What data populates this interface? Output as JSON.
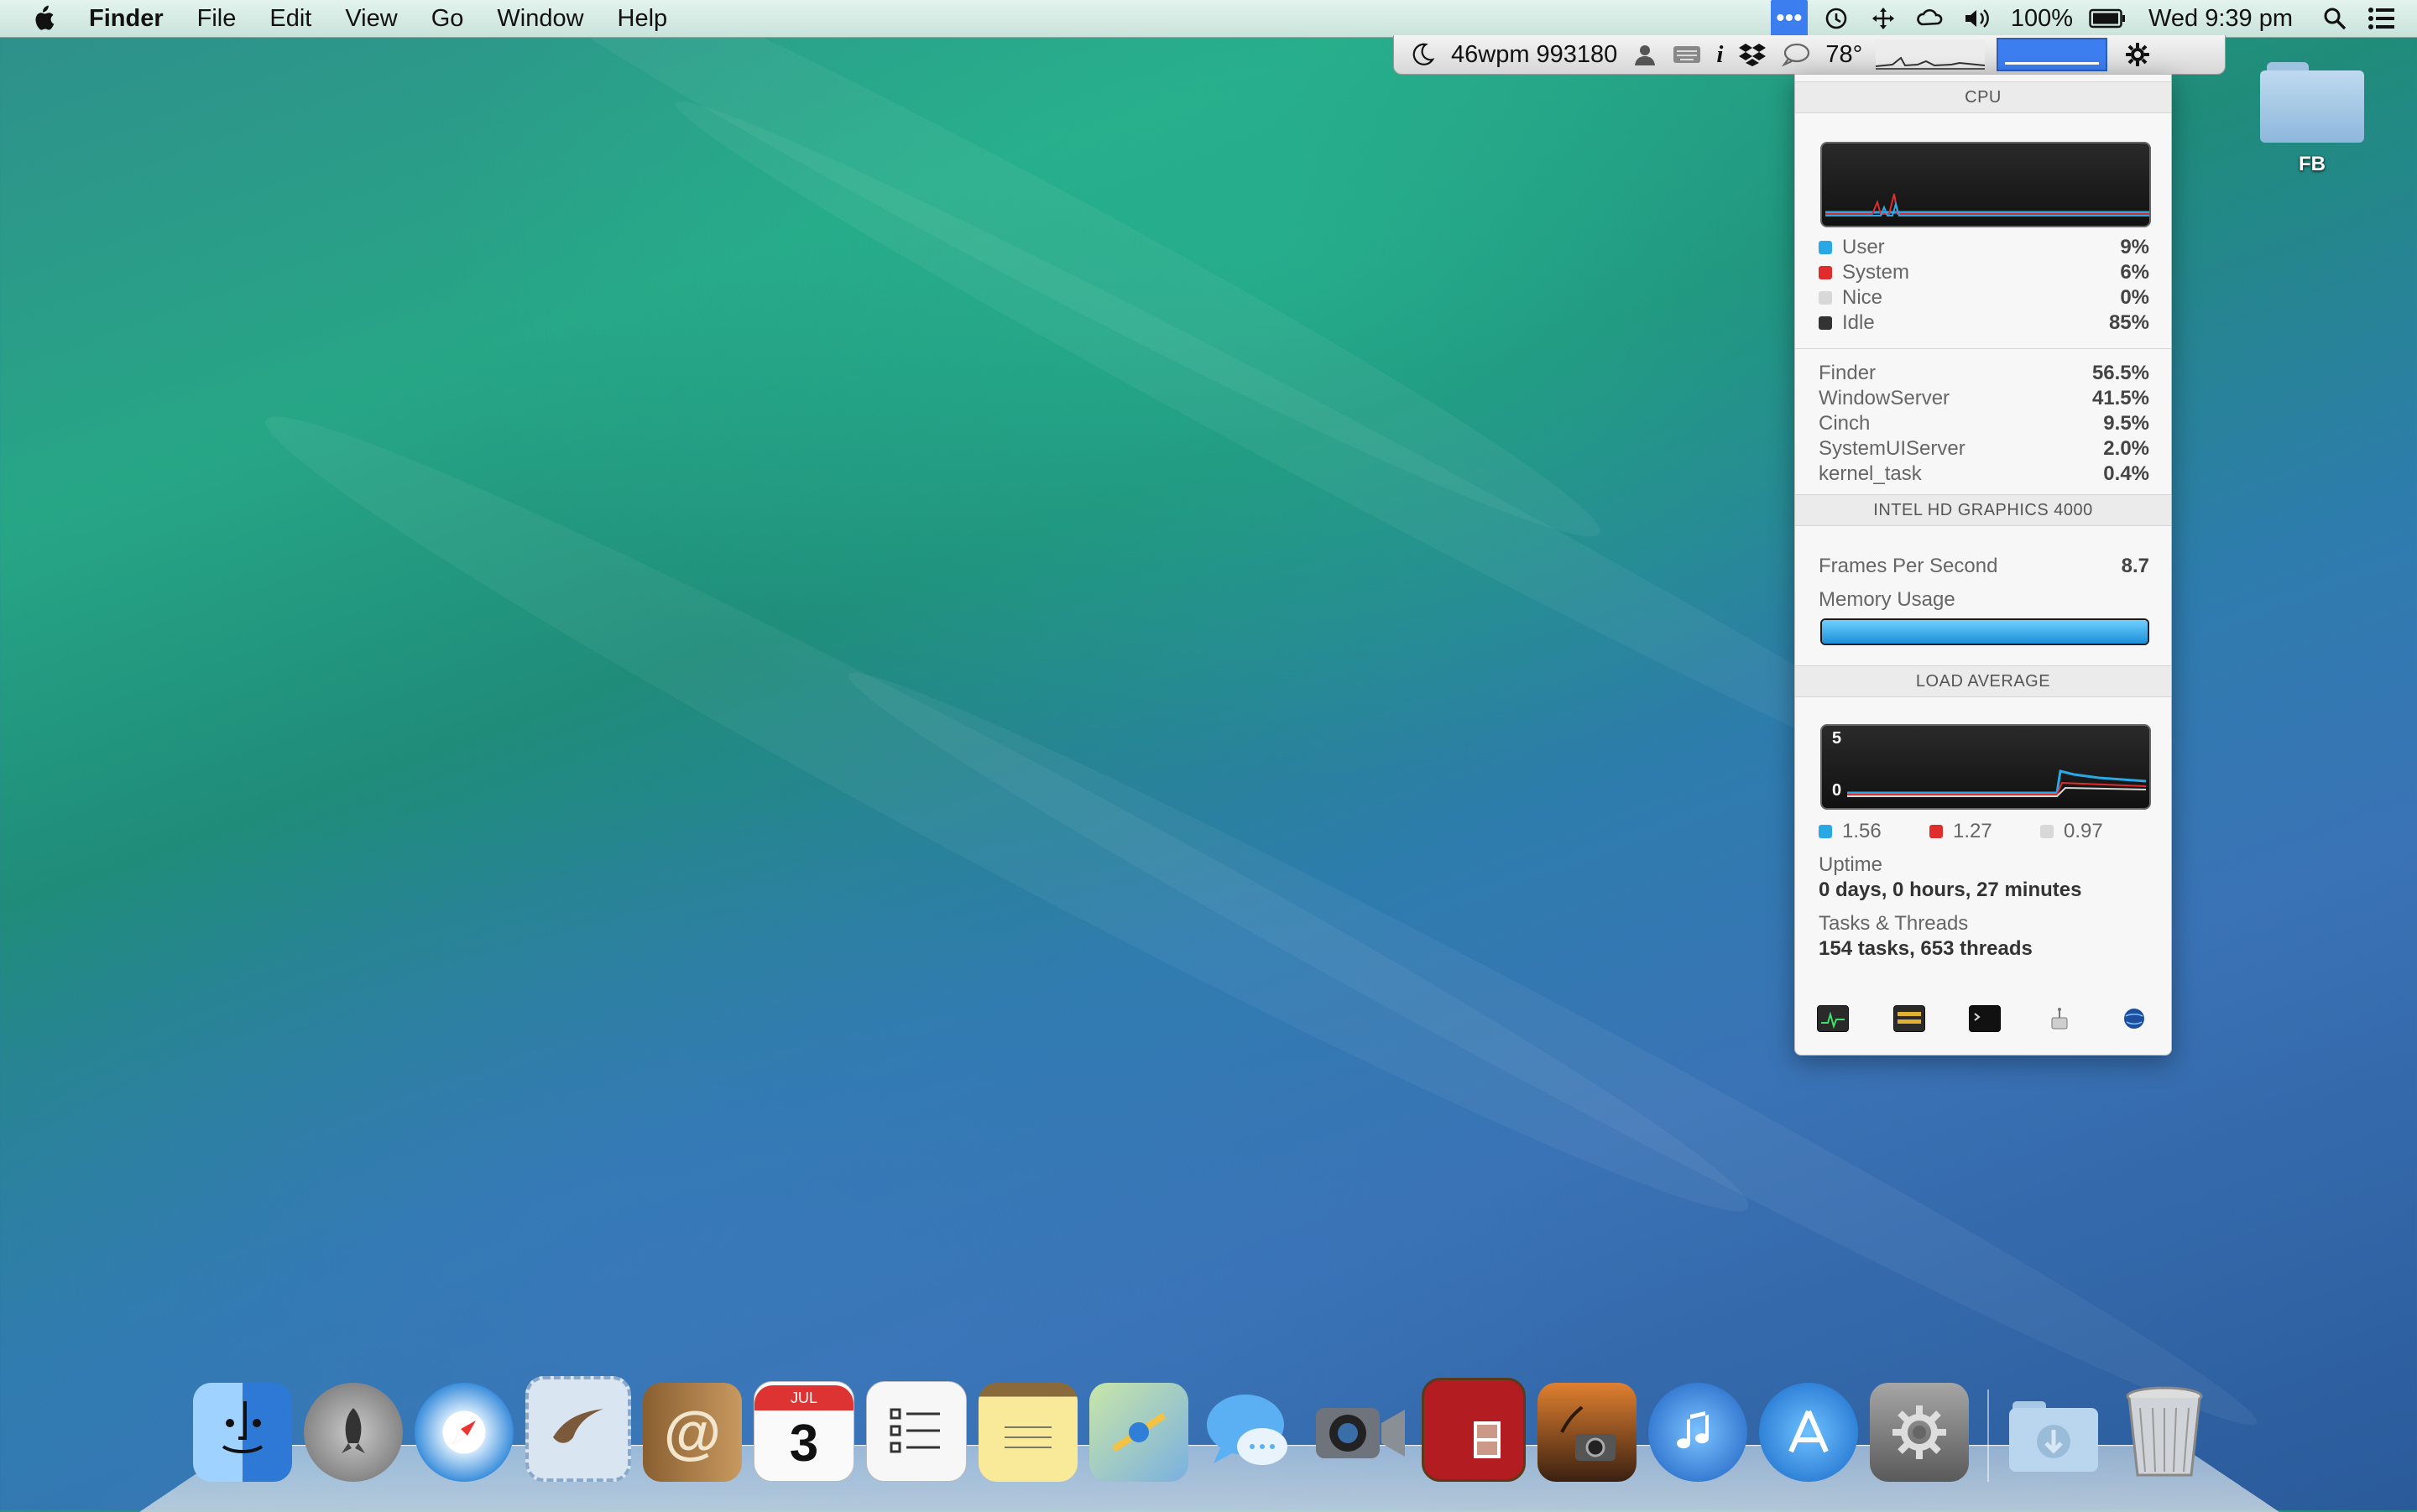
{
  "menubar": {
    "app_name": "Finder",
    "menus": [
      "File",
      "Edit",
      "View",
      "Go",
      "Window",
      "Help"
    ],
    "battery": "100%",
    "clock": "Wed 9:39 pm"
  },
  "statusbar": {
    "typing_stats": "46wpm 993180",
    "temperature": "78°"
  },
  "panel": {
    "cpu_header": "CPU",
    "cpu_legend": [
      {
        "label": "User",
        "value": "9%",
        "color": "#2aa8e6"
      },
      {
        "label": "System",
        "value": "6%",
        "color": "#e02c2c"
      },
      {
        "label": "Nice",
        "value": "0%",
        "color": "#d8d8d8"
      },
      {
        "label": "Idle",
        "value": "85%",
        "color": "#333333"
      }
    ],
    "processes": [
      {
        "name": "Finder",
        "value": "56.5%"
      },
      {
        "name": "WindowServer",
        "value": "41.5%"
      },
      {
        "name": "Cinch",
        "value": "9.5%"
      },
      {
        "name": "SystemUIServer",
        "value": "2.0%"
      },
      {
        "name": "kernel_task",
        "value": "0.4%"
      }
    ],
    "gpu_header": "INTEL HD GRAPHICS 4000",
    "fps_label": "Frames Per Second",
    "fps_value": "8.7",
    "memory_label": "Memory Usage",
    "memory_fraction": 1.0,
    "load_header": "LOAD AVERAGE",
    "load_scale_max": "5",
    "load_scale_min": "0",
    "load_values": [
      {
        "value": "1.56",
        "color": "#2aa8e6"
      },
      {
        "value": "1.27",
        "color": "#e02c2c"
      },
      {
        "value": "0.97",
        "color": "#d8d8d8"
      }
    ],
    "uptime_label": "Uptime",
    "uptime_value": "0 days, 0 hours, 27 minutes",
    "tasks_label": "Tasks & Threads",
    "tasks_value": "154 tasks, 653 threads"
  },
  "desktop": {
    "folder_name": "FB"
  },
  "dock": {
    "items": [
      {
        "name": "finder",
        "color": "#4c9be8"
      },
      {
        "name": "launchpad",
        "color": "#8e8e8e"
      },
      {
        "name": "safari",
        "color": "#3b8fd6"
      },
      {
        "name": "mail",
        "color": "#8fb3d8"
      },
      {
        "name": "contacts",
        "color": "#b68a4c"
      },
      {
        "name": "calendar",
        "color": "#f2f2f2"
      },
      {
        "name": "reminders",
        "color": "#f4f4f4"
      },
      {
        "name": "notes",
        "color": "#f4e38a"
      },
      {
        "name": "maps",
        "color": "#9dc97a"
      },
      {
        "name": "messages",
        "color": "#5aaef0"
      },
      {
        "name": "facetime",
        "color": "#7a8089"
      },
      {
        "name": "photo-booth",
        "color": "#c0262a"
      },
      {
        "name": "iphoto",
        "color": "#6f4a2a"
      },
      {
        "name": "itunes",
        "color": "#2b7fd9"
      },
      {
        "name": "app-store",
        "color": "#2a86e0"
      },
      {
        "name": "system-preferences",
        "color": "#8a8a8a"
      }
    ],
    "calendar_month": "JUL",
    "calendar_day": "3"
  }
}
